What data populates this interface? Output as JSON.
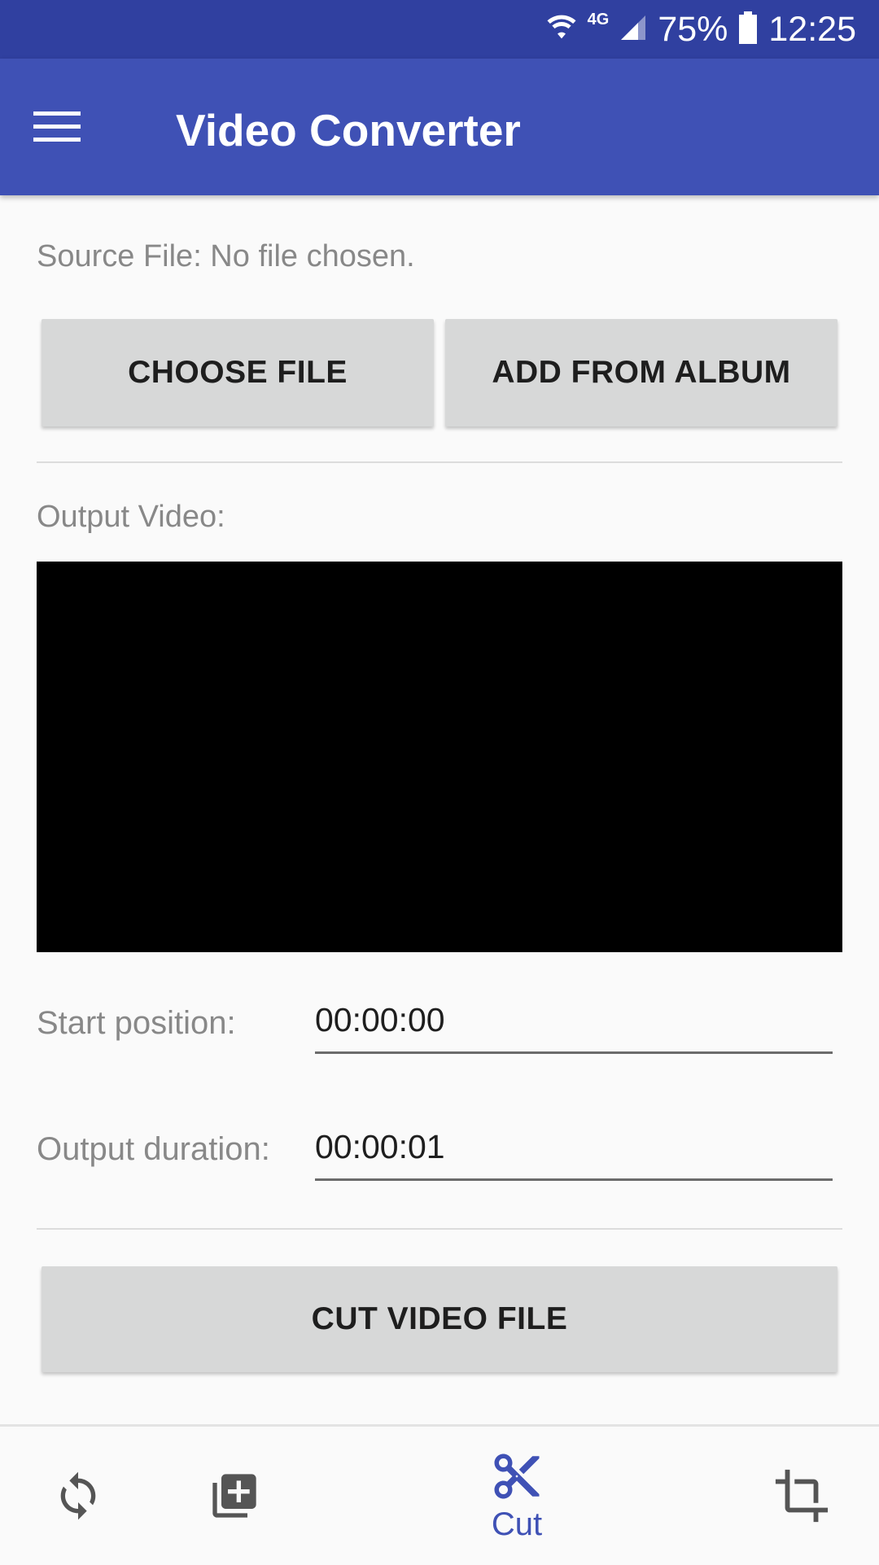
{
  "status_bar": {
    "network": "4G",
    "battery_percent": "75%",
    "time": "12:25"
  },
  "app_bar": {
    "title": "Video Converter"
  },
  "source": {
    "label": "Source File: No file chosen.",
    "choose_button": "CHOOSE FILE",
    "album_button": "ADD FROM ALBUM"
  },
  "output": {
    "label": "Output Video:"
  },
  "fields": {
    "start_label": "Start position:",
    "start_value": "00:00:00",
    "duration_label": "Output duration:",
    "duration_value": "00:00:01"
  },
  "actions": {
    "cut_button": "CUT VIDEO FILE"
  },
  "bottom_nav": {
    "active_label": "Cut",
    "accent_color": "#3f51b5",
    "inactive_color": "#555555",
    "items": [
      "convert-icon",
      "merge-icon",
      "cut-icon",
      "crop-icon"
    ]
  }
}
